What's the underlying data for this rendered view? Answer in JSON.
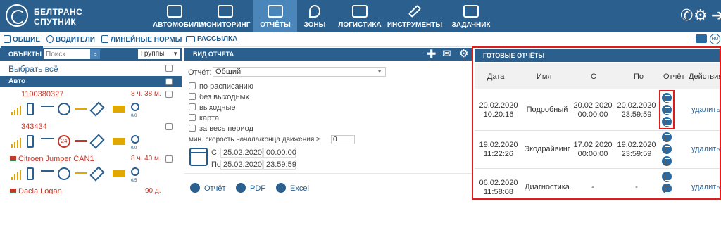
{
  "brand": {
    "line1": "БЕЛТРАНС",
    "line2": "СПУТНИК"
  },
  "nav": [
    {
      "label": "АВТОМОБИЛИ",
      "icon": "car-icon"
    },
    {
      "label": "МОНИТОРИНГ",
      "icon": "monitor-icon"
    },
    {
      "label": "ОТЧЁТЫ",
      "icon": "report-icon",
      "active": true
    },
    {
      "label": "ЗОНЫ",
      "icon": "map-pin-icon"
    },
    {
      "label": "ЛОГИСТИКА",
      "icon": "truck-icon"
    },
    {
      "label": "ИНСТРУМЕНТЫ",
      "icon": "wrench-icon"
    },
    {
      "label": "ЗАДАЧНИК",
      "icon": "tasks-icon"
    }
  ],
  "subnav": [
    {
      "label": "ОБЩИЕ",
      "active": true
    },
    {
      "label": "ВОДИТЕЛИ"
    },
    {
      "label": "ЛИНЕЙНЫЕ НОРМЫ"
    },
    {
      "label": "РАССЫЛКА"
    }
  ],
  "lang": "RU",
  "left": {
    "title": "ОБЪЕКТЫ",
    "search_placeholder": "Поиск",
    "groups": "Группы",
    "select_all": "Выбрать всё",
    "group_name": "Авто",
    "vehicles": [
      {
        "name": "1100380327",
        "time": "8 ч. 38 м.",
        "sub": "0/0"
      },
      {
        "name": "343434",
        "time": "",
        "badge": "24",
        "sub": "0/0"
      },
      {
        "name": "Citroen Jumper CAN1",
        "time": "8 ч. 40 м.",
        "sub": "0/5"
      },
      {
        "name": "Dacia Logan",
        "time": "90 д."
      }
    ]
  },
  "middle": {
    "title": "ВИД ОТЧЁТА",
    "report_label": "Отчёт:",
    "report_value": "Общий",
    "options": [
      "по расписанию",
      "без выходных",
      "выходные",
      "карта",
      "за весь период"
    ],
    "speed_label": "мин. скорость начала/конца движения ≥",
    "speed_value": "0",
    "from_label": "С",
    "to_label": "По",
    "from_date": "25.02.2020",
    "from_time": "00:00:00",
    "to_date": "25.02.2020",
    "to_time": "23:59:59",
    "buttons": [
      "Отчёт",
      "PDF",
      "Excel"
    ]
  },
  "right": {
    "title": "ГОТОВЫЕ ОТЧЁТЫ",
    "columns": [
      "Дата",
      "Имя",
      "С",
      "По",
      "Отчёт",
      "Действия"
    ],
    "rows": [
      {
        "date": "20.02.2020",
        "time": "10:20:16",
        "name": "Подробный",
        "from_d": "20.02.2020",
        "from_t": "00:00:00",
        "to_d": "20.02.2020",
        "to_t": "23:59:59",
        "action": "удалить"
      },
      {
        "date": "19.02.2020",
        "time": "11:22:26",
        "name": "Экодрайвинг",
        "from_d": "17.02.2020",
        "from_t": "00:00:00",
        "to_d": "19.02.2020",
        "to_t": "23:59:59",
        "action": "удалить"
      },
      {
        "date": "06.02.2020",
        "time": "11:58:08",
        "name": "Диагностика",
        "from_d": "-",
        "from_t": "",
        "to_d": "-",
        "to_t": "",
        "action": "удалить"
      }
    ]
  }
}
